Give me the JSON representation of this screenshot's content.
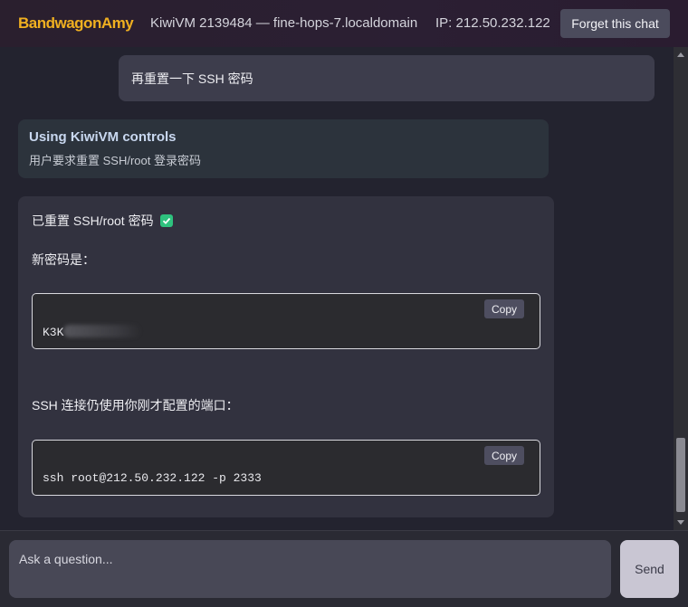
{
  "header": {
    "brand": "BandwagonAmy",
    "title": "KiwiVM 2139484 — fine-hops-7.localdomain",
    "ip": "IP: 212.50.232.122",
    "forget_label": "Forget this chat"
  },
  "messages": {
    "user": "再重置一下 SSH 密码",
    "tool": {
      "title": "Using KiwiVM controls",
      "description": "用户要求重置 SSH/root 登录密码"
    },
    "reply": {
      "line1": "已重置 SSH/root 密码",
      "line2": "新密码是：",
      "password_visible": "K3K",
      "line3": "SSH 连接仍使用你刚才配置的端口：",
      "ssh_command": "ssh root@212.50.232.122 -p 2333",
      "copy_label": "Copy"
    }
  },
  "composer": {
    "placeholder": "Ask a question...",
    "send_label": "Send"
  },
  "colors": {
    "brand": "#f0b020",
    "check": "#2ec27e",
    "send_button": "#c9c6d3"
  }
}
